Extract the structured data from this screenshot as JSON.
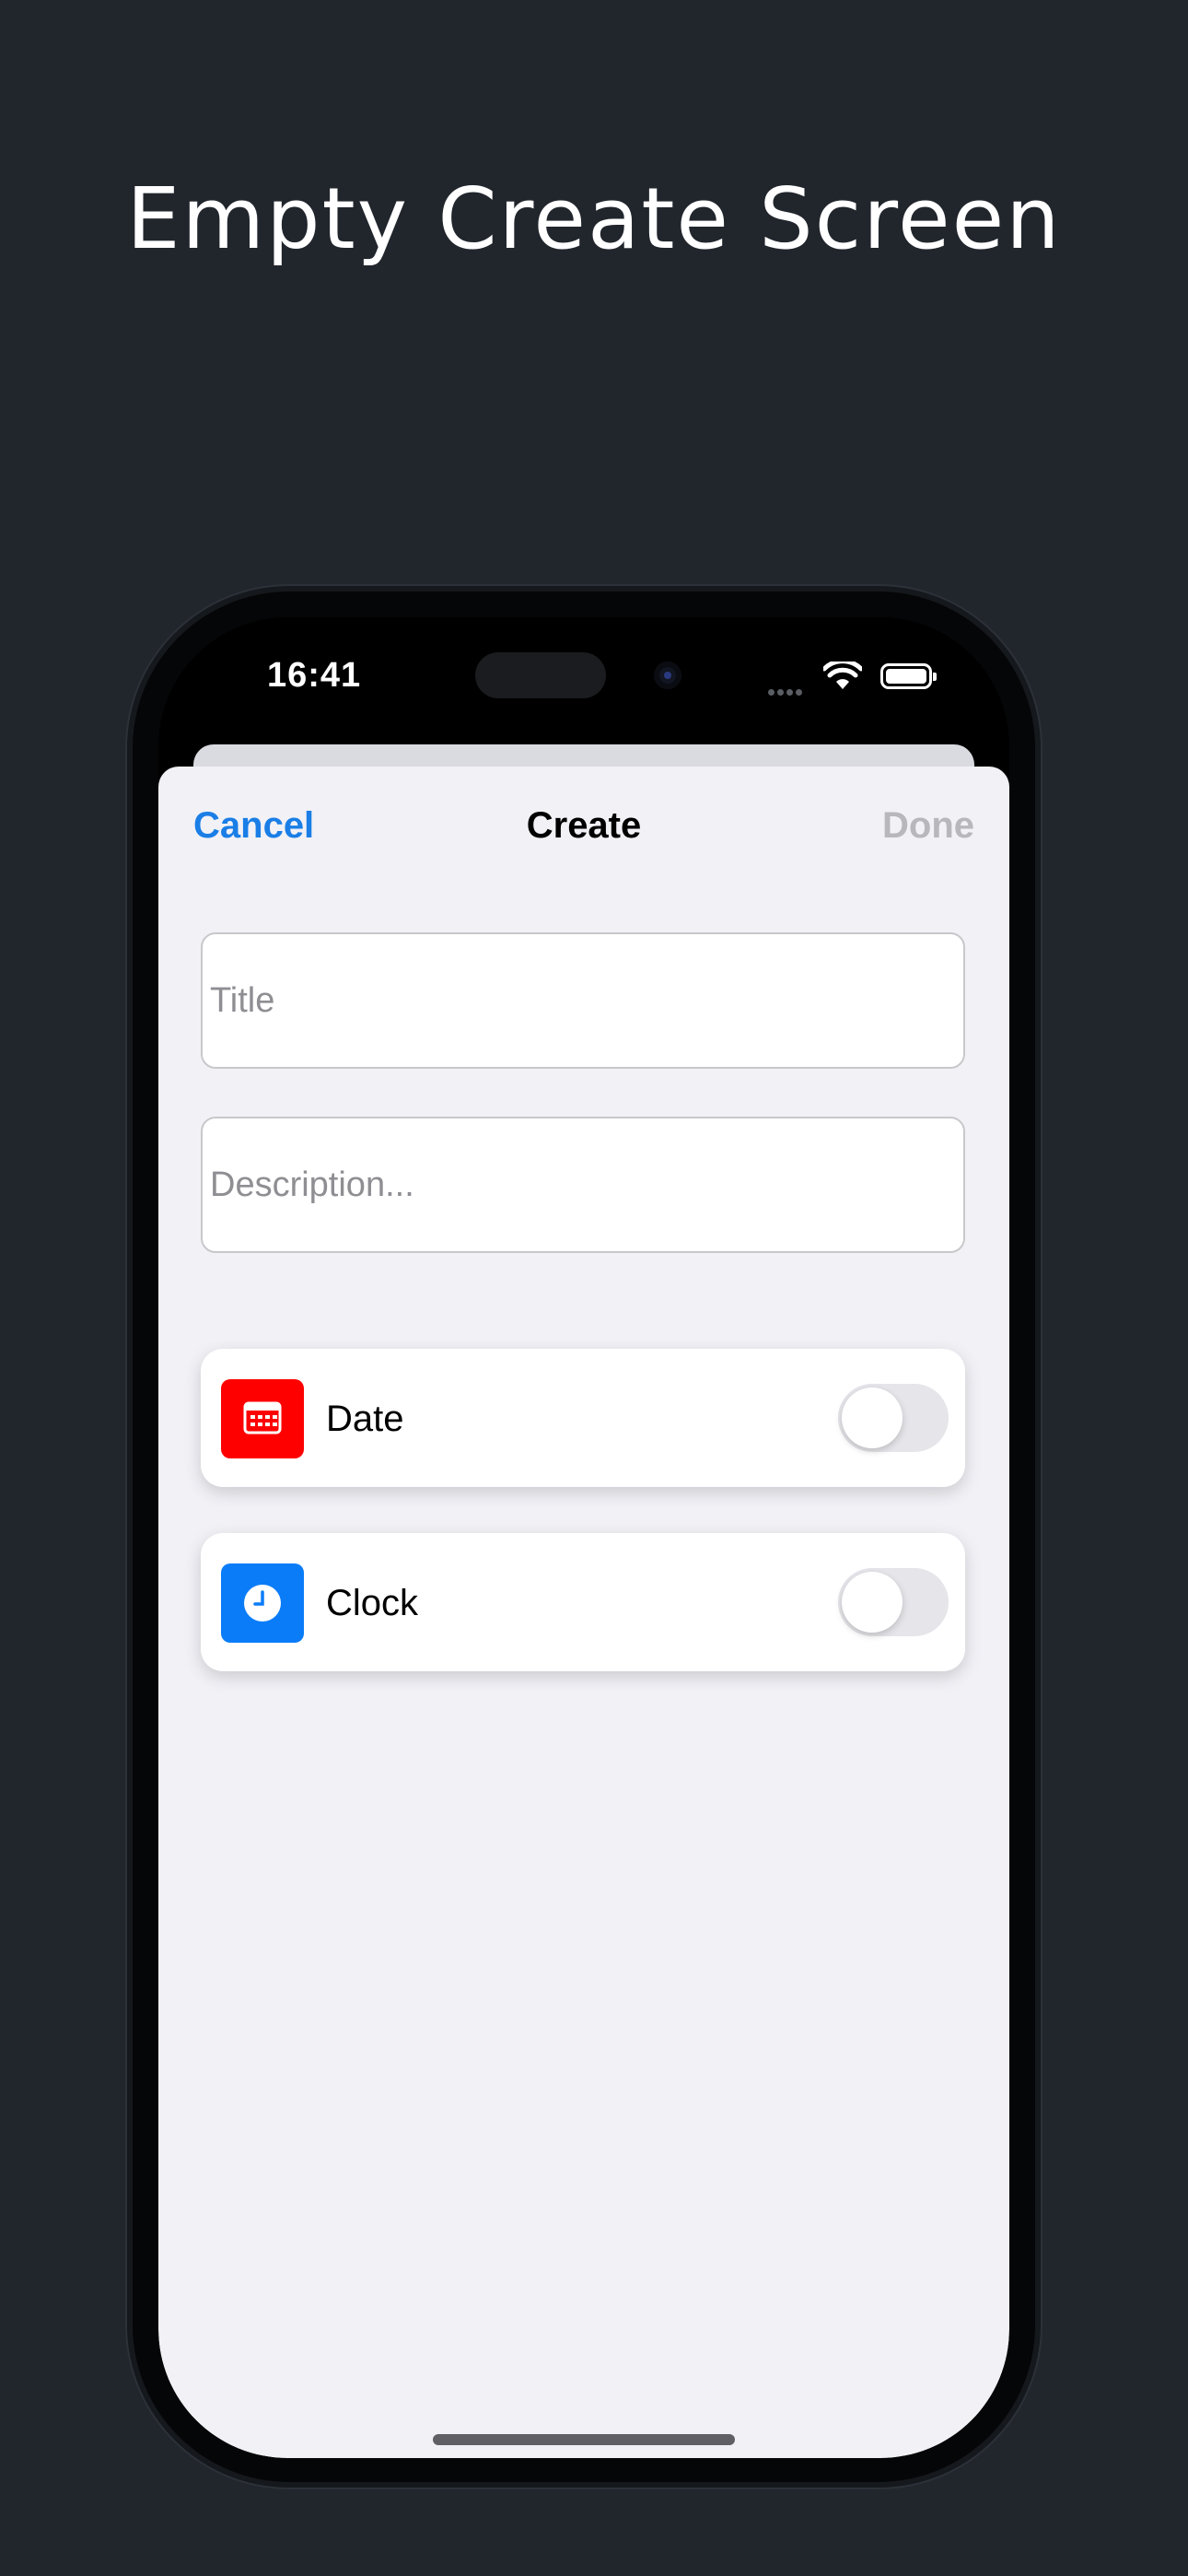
{
  "page": {
    "headline": "Empty Create Screen"
  },
  "status_bar": {
    "time": "16:41"
  },
  "nav": {
    "cancel_label": "Cancel",
    "title": "Create",
    "done_label": "Done"
  },
  "form": {
    "title_placeholder": "Title",
    "title_value": "",
    "description_placeholder": "Description...",
    "description_value": ""
  },
  "options": {
    "date": {
      "label": "Date",
      "icon": "calendar-icon",
      "icon_color": "#fe0000",
      "enabled": false
    },
    "clock": {
      "label": "Clock",
      "icon": "clock-icon",
      "icon_color": "#0a7cf8",
      "enabled": false
    }
  },
  "colors": {
    "background": "#21252c",
    "accent": "#1a7ee6",
    "disabled": "#b7b7bc",
    "sheet": "#f1f1f6"
  }
}
